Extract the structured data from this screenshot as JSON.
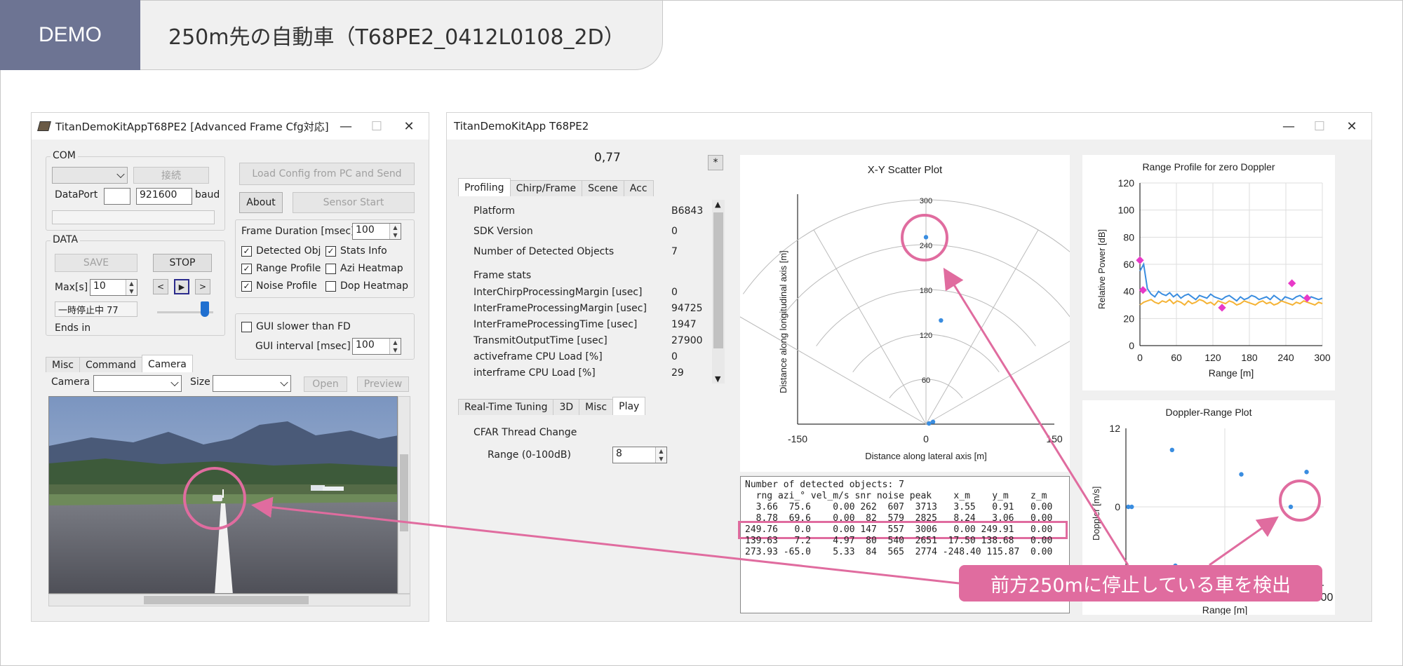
{
  "slide": {
    "badge": "DEMO",
    "title": "250m先の自動車（T68PE2_0412L0108_2D）",
    "callout": "前方250mに停止している車を検出",
    "accent": "#e06c9f",
    "badge_bg": "#6d7493"
  },
  "left_window": {
    "title": "TitanDemoKitAppT68PE2 [Advanced Frame Cfg対応]",
    "com": {
      "label": "COM",
      "connect": "接続",
      "dataport_label": "DataPort",
      "baud_value": "921600",
      "baud_label": "baud"
    },
    "load_config": "Load Config from PC and Send",
    "about": "About",
    "sensor_start": "Sensor Start",
    "frame_duration_label": "Frame Duration [msec]",
    "frame_duration_value": "100",
    "checks": [
      {
        "label": "Detected Obj",
        "checked": true
      },
      {
        "label": "Stats Info",
        "checked": true
      },
      {
        "label": "Range Profile",
        "checked": true
      },
      {
        "label": "Azi Heatmap",
        "checked": false
      },
      {
        "label": "Noise Profile",
        "checked": true
      },
      {
        "label": "Dop Heatmap",
        "checked": false
      }
    ],
    "data": {
      "label": "DATA",
      "save": "SAVE",
      "stop": "STOP",
      "max_label": "Max[s]",
      "max_value": "10",
      "status": "一時停止中 77",
      "ends_in": "Ends in",
      "slider_level": 0.85
    },
    "gui_slower": "GUI slower than FD",
    "gui_interval_label": "GUI interval [msec]",
    "gui_interval_value": "100",
    "tabs": [
      "Misc",
      "Command",
      "Camera"
    ],
    "active_tab": "Camera",
    "camera_label": "Camera",
    "size_label": "Size",
    "open": "Open",
    "preview": "Preview"
  },
  "right_window": {
    "title": "TitanDemoKitApp T68PE2",
    "frame_counter": "0,77",
    "star_btn": "*",
    "tabs": [
      "Profiling",
      "Chirp/Frame",
      "Scene",
      "Acc"
    ],
    "active_tab": "Profiling",
    "profiling": [
      {
        "k": "Platform",
        "v": "B6843"
      },
      {
        "k": "SDK Version",
        "v": "0"
      },
      {
        "k": "Number of Detected Objects",
        "v": "7"
      },
      {
        "k": "Frame stats",
        "v": ""
      },
      {
        "k": "InterChirpProcessingMargin [usec]",
        "v": "0"
      },
      {
        "k": "InterFrameProcessingMargin [usec]",
        "v": "94725"
      },
      {
        "k": "InterFrameProcessingTime [usec]",
        "v": "1947"
      },
      {
        "k": "TransmitOutputTime [usec]",
        "v": "27900"
      },
      {
        "k": "activeframe CPU Load [%]",
        "v": "0"
      },
      {
        "k": "interframe CPU Load [%]",
        "v": "29"
      }
    ],
    "tabs2": [
      "Real-Time Tuning",
      "3D",
      "Misc",
      "Play"
    ],
    "active_tab2": "Play",
    "cfar_label": "CFAR Thread Change",
    "range_label": "Range (0-100dB)",
    "range_value": "8",
    "table": {
      "count_line": "Number of detected objects: 7",
      "header": "  rng azi_° vel_m/s snr noise peak    x_m    y_m    z_m",
      "rows": [
        "  3.66  75.6    0.00 262  607  3713   3.55   0.91   0.00",
        "  8.78  69.6    0.00  82  579  2825   8.24   3.06   0.00",
        "249.76   0.0    0.00 147  557  3006   0.00 249.91   0.00",
        "139.63   7.2    4.97  80  540  2651  17.50 138.68   0.00",
        "273.93 -65.0    5.33  84  565  2774 -248.40 115.87  0.00"
      ],
      "highlight_index": 2
    }
  },
  "chart_data": [
    {
      "type": "scatter",
      "title": "X-Y Scatter Plot",
      "xlabel": "Distance along lateral axis [m]",
      "ylabel": "Distance along longitudinal axis [m]",
      "xlim": [
        -150,
        150
      ],
      "ylim": [
        0,
        300
      ],
      "radial_ticks": [
        60,
        120,
        180,
        240,
        300
      ],
      "x_ticks": [
        -150,
        0,
        150
      ],
      "points": [
        {
          "x": 0,
          "y": 250
        },
        {
          "x": 17.5,
          "y": 138.7
        },
        {
          "x": 3.55,
          "y": 0.91
        },
        {
          "x": 8.24,
          "y": 3.06
        }
      ],
      "color": "#3a8de0"
    },
    {
      "type": "line",
      "title": "Range Profile for zero Doppler",
      "xlabel": "Range [m]",
      "ylabel": "Relative Power [dB]",
      "xlim": [
        0,
        300
      ],
      "ylim": [
        0,
        120
      ],
      "x_ticks": [
        0,
        60,
        120,
        180,
        240,
        300
      ],
      "y_ticks": [
        0,
        20,
        40,
        60,
        80,
        100,
        120
      ],
      "series": [
        {
          "color": "#3a8de0",
          "values": [
            55,
            60,
            42,
            38,
            36,
            40,
            38,
            37,
            39,
            36,
            38,
            35,
            37,
            38,
            36,
            34,
            37,
            36,
            35,
            38,
            36,
            35,
            34,
            36,
            37,
            35,
            33,
            36,
            34,
            35,
            37,
            36,
            34,
            35,
            36,
            34,
            37,
            35,
            33,
            36,
            35,
            34,
            36,
            37,
            35,
            34,
            36,
            35,
            34,
            35
          ]
        },
        {
          "color": "#f5b335",
          "values": [
            30,
            32,
            33,
            34,
            32,
            31,
            33,
            32,
            34,
            31,
            33,
            32,
            30,
            33,
            31,
            32,
            34,
            33,
            31,
            32,
            30,
            33,
            32,
            31,
            33,
            32,
            30,
            31,
            33,
            32,
            31,
            30,
            32,
            33,
            31,
            32,
            30,
            31,
            33,
            32,
            31,
            30,
            32,
            31,
            33,
            32,
            31,
            30,
            32,
            31
          ]
        }
      ],
      "markers": [
        {
          "x": 0,
          "y": 63
        },
        {
          "x": 5,
          "y": 41
        },
        {
          "x": 135,
          "y": 28
        },
        {
          "x": 250,
          "y": 46
        },
        {
          "x": 275,
          "y": 35
        }
      ],
      "marker_color": "#e83ac8"
    },
    {
      "type": "scatter",
      "title": "Doppler-Range Plot",
      "xlabel": "Range [m]",
      "ylabel": "Doppler [m/s]",
      "xlim": [
        0,
        300
      ],
      "ylim": [
        -12,
        12
      ],
      "y_ticks": [
        0,
        12
      ],
      "x_ticks": [
        300
      ],
      "points": [
        {
          "x": 3.66,
          "y": 0
        },
        {
          "x": 8.78,
          "y": 0
        },
        {
          "x": 70,
          "y": 8.7
        },
        {
          "x": 75,
          "y": -9
        },
        {
          "x": 175,
          "y": 4.97
        },
        {
          "x": 250,
          "y": 0
        },
        {
          "x": 274,
          "y": 5.33
        }
      ],
      "color": "#3a8de0"
    }
  ]
}
